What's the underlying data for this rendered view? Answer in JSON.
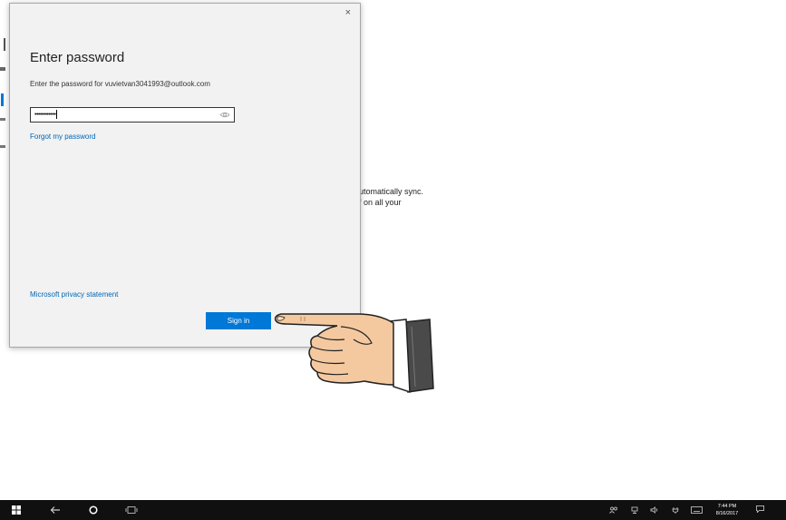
{
  "background": {
    "text_line1": "utomatically sync.",
    "text_line2": "f on all your"
  },
  "dialog": {
    "close_label": "×",
    "title": "Enter password",
    "prompt": "Enter the password for vuvietvan3041993@outlook.com",
    "password_mask": "••••••••••••",
    "forgot_link": "Forgot my password",
    "privacy_link": "Microsoft privacy statement",
    "signin_label": "Sign in"
  },
  "taskbar": {
    "time": "7:44 PM",
    "date": "8/16/2017",
    "icons": [
      "windows-start-icon",
      "back-arrow-icon",
      "cortana-circle-icon",
      "task-view-icon",
      "tray-icons",
      "action-center-icon"
    ]
  },
  "colors": {
    "accent": "#0078d7",
    "link": "#0066b4",
    "taskbar": "#101010",
    "dialog_bg": "#f2f2f2"
  }
}
